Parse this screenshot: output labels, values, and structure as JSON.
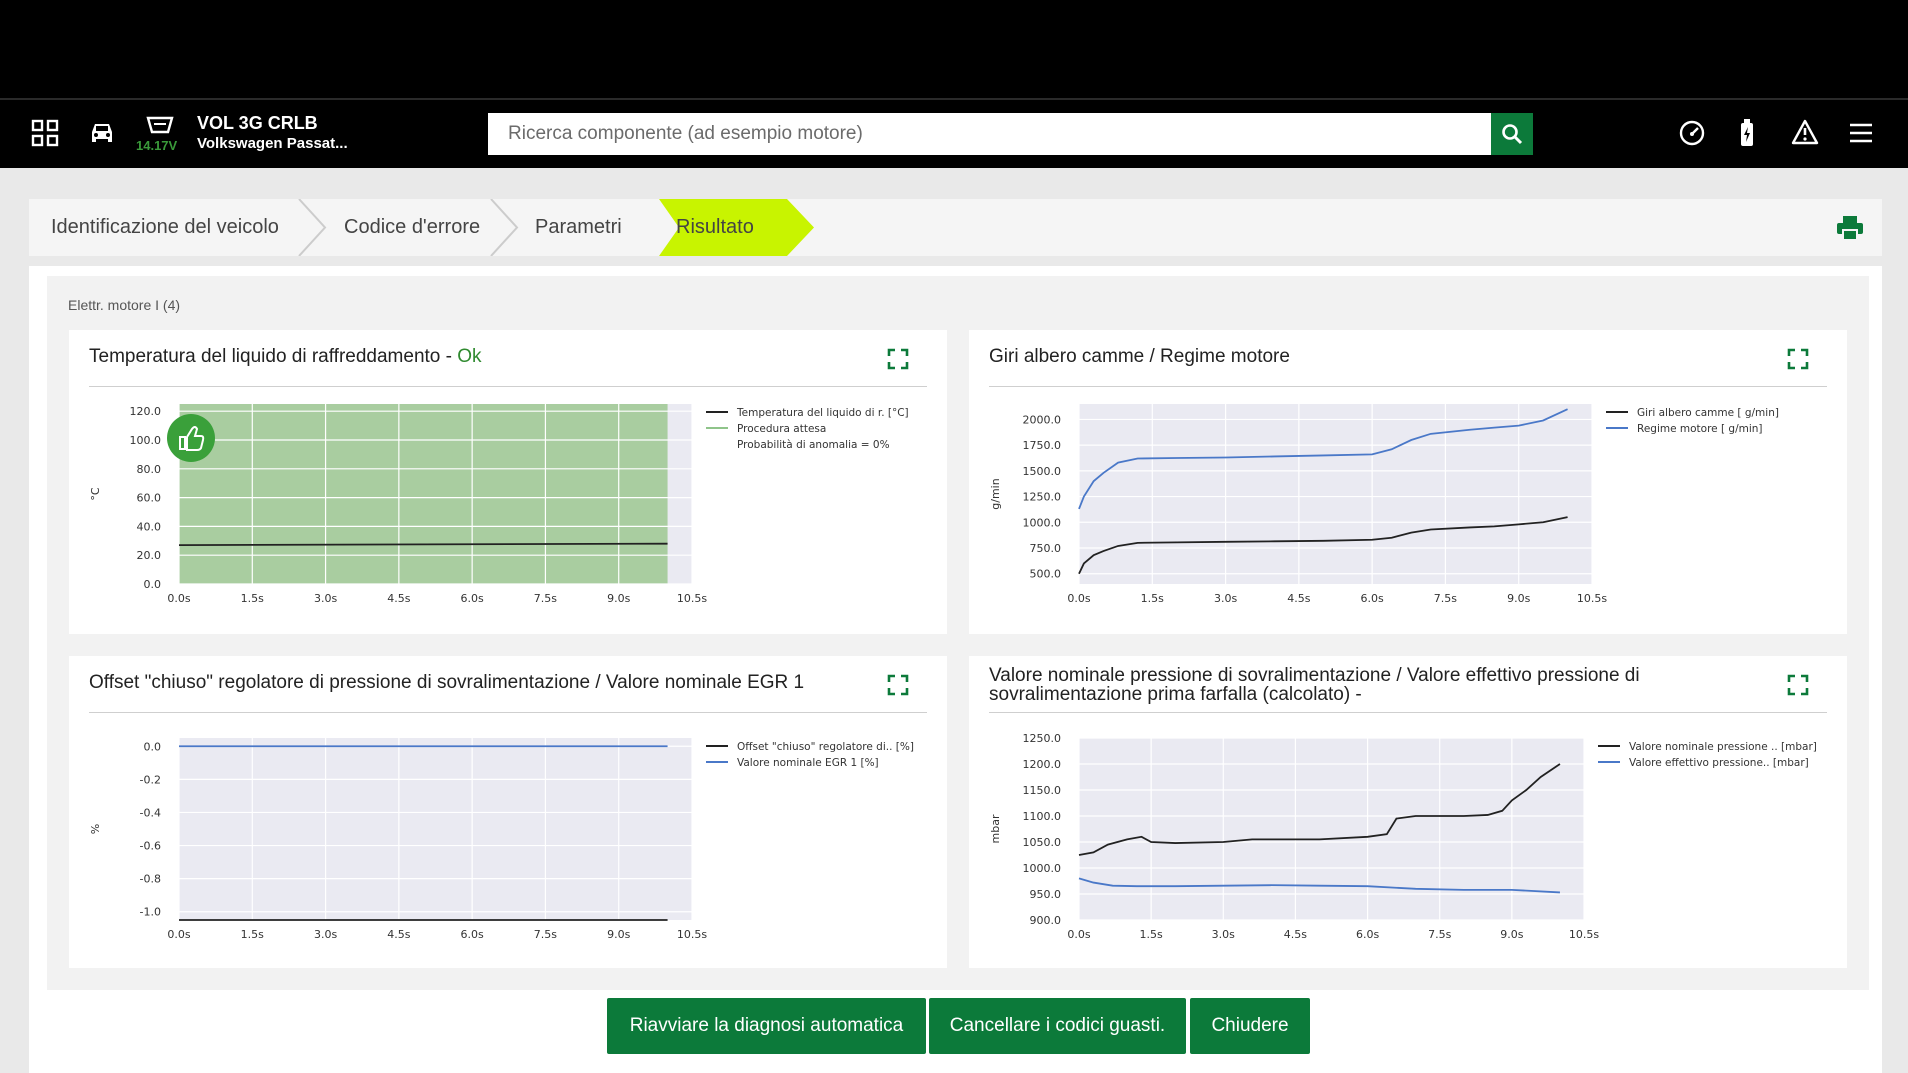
{
  "header": {
    "vehicle_code": "VOL 3G CRLB",
    "vehicle_model": "Volkswagen Passat...",
    "voltage": "14.17V",
    "search_placeholder": "Ricerca componente (ad esempio motore)"
  },
  "breadcrumb": {
    "steps": [
      "Identificazione del veicolo",
      "Codice d'errore",
      "Parametri",
      "Risultato"
    ],
    "active": "Risultato",
    "active_color": "#c8f400"
  },
  "section_label": "Elettr. motore I (4)",
  "panels": [
    {
      "title": "Temperatura del liquido di raffreddamento",
      "status_sep": "-",
      "status": "Ok"
    },
    {
      "title": "Giri albero camme / Regime motore"
    },
    {
      "title": "Offset \"chiuso\" regolatore di pressione di sovralimentazione / Valore nominale EGR 1"
    },
    {
      "title": "Valore nominale pressione di sovralimentazione / Valore effettivo pressione di sovralimentazione prima farfalla (calcolato)  -"
    }
  ],
  "buttons": {
    "restart": "Riavviare la diagnosi automatica",
    "clear": "Cancellare i codici guasti.",
    "close": "Chiudere"
  },
  "colors": {
    "brand_green": "#0c7a3a",
    "series_black": "#222222",
    "series_blue": "#4a78c8"
  },
  "chart_data": [
    {
      "type": "line",
      "title": "Temperatura del liquido di raffreddamento",
      "ylabel": "°C",
      "ylim": [
        0,
        125
      ],
      "yticks": [
        "120.0",
        "100.0",
        "80.0",
        "60.0",
        "40.0",
        "20.0",
        "0.0"
      ],
      "ytick_values": [
        120,
        100,
        80,
        60,
        40,
        20,
        0
      ],
      "xticks": [
        "0.0s",
        "1.5s",
        "3.0s",
        "4.5s",
        "6.0s",
        "7.5s",
        "9.0s",
        "10.5s"
      ],
      "xlim": [
        0,
        10.5
      ],
      "band": {
        "x": [
          0,
          10
        ],
        "y": [
          0,
          130
        ],
        "color": "#a9cda0"
      },
      "series": [
        {
          "name": "Temperatura del liquido di r. [°C]",
          "color": "#222222",
          "x": [
            0,
            10
          ],
          "y": [
            27,
            28
          ]
        },
        {
          "name": "Procedura attesa",
          "color": "#8fc48a",
          "legend_only": true
        }
      ],
      "legend_extra": "Probabilità di anomalia =   0%",
      "legend_position": "right"
    },
    {
      "type": "line",
      "title": "Giri albero camme / Regime motore",
      "ylabel": "g/min",
      "ylim": [
        400,
        2150
      ],
      "yticks": [
        "2000.0",
        "1750.0",
        "1500.0",
        "1250.0",
        "1000.0",
        "750.0",
        "500.0"
      ],
      "ytick_values": [
        2000,
        1750,
        1500,
        1250,
        1000,
        750,
        500
      ],
      "xticks": [
        "0.0s",
        "1.5s",
        "3.0s",
        "4.5s",
        "6.0s",
        "7.5s",
        "9.0s",
        "10.5s"
      ],
      "xlim": [
        0,
        10.5
      ],
      "series": [
        {
          "name": "Giri albero camme [ g/min]",
          "color": "#222222",
          "x": [
            0,
            0.1,
            0.3,
            0.5,
            0.8,
            1.2,
            2,
            3,
            4,
            5,
            6,
            6.4,
            6.8,
            7.2,
            8,
            8.5,
            9,
            9.5,
            10
          ],
          "y": [
            500,
            600,
            680,
            720,
            770,
            800,
            805,
            810,
            815,
            820,
            830,
            850,
            900,
            930,
            950,
            960,
            980,
            1000,
            1050
          ]
        },
        {
          "name": "Regime motore [ g/min]",
          "color": "#4a78c8",
          "x": [
            0,
            0.1,
            0.3,
            0.5,
            0.8,
            1.2,
            2,
            3,
            4,
            5,
            6,
            6.4,
            6.8,
            7.2,
            8,
            8.5,
            9,
            9.5,
            10
          ],
          "y": [
            1130,
            1250,
            1400,
            1480,
            1580,
            1620,
            1625,
            1630,
            1640,
            1650,
            1660,
            1710,
            1800,
            1860,
            1900,
            1920,
            1940,
            1990,
            2100
          ]
        }
      ],
      "legend_position": "right"
    },
    {
      "type": "line",
      "title": "Offset \"chiuso\" regolatore di pressione di sovralimentazione / Valore nominale EGR 1",
      "ylabel": "%",
      "ylim": [
        -1.05,
        0.05
      ],
      "yticks": [
        "0.0",
        "-0.2",
        "-0.4",
        "-0.6",
        "-0.8",
        "-1.0"
      ],
      "ytick_values": [
        0,
        -0.2,
        -0.4,
        -0.6,
        -0.8,
        -1.0
      ],
      "xticks": [
        "0.0s",
        "1.5s",
        "3.0s",
        "4.5s",
        "6.0s",
        "7.5s",
        "9.0s",
        "10.5s"
      ],
      "xlim": [
        0,
        10.5
      ],
      "series": [
        {
          "name": "Offset \"chiuso\" regolatore di.. [%]",
          "color": "#222222",
          "x": [
            0,
            10
          ],
          "y": [
            -1.05,
            -1.05
          ]
        },
        {
          "name": "Valore nominale EGR 1 [%]",
          "color": "#4a78c8",
          "x": [
            0,
            10
          ],
          "y": [
            0,
            0
          ]
        }
      ],
      "legend_position": "right"
    },
    {
      "type": "line",
      "title": "Valore nominale pressione di sovralimentazione / Valore effettivo pressione di sovralimentazione prima farfalla (calcolato)",
      "ylabel": "mbar",
      "ylim": [
        900,
        1250
      ],
      "yticks": [
        "1250.0",
        "1200.0",
        "1150.0",
        "1100.0",
        "1050.0",
        "1000.0",
        "950.0",
        "900.0"
      ],
      "ytick_values": [
        1250,
        1200,
        1150,
        1100,
        1050,
        1000,
        950,
        900
      ],
      "xticks": [
        "0.0s",
        "1.5s",
        "3.0s",
        "4.5s",
        "6.0s",
        "7.5s",
        "9.0s",
        "10.5s"
      ],
      "xlim": [
        0,
        10.5
      ],
      "series": [
        {
          "name": "Valore nominale pressione .. [mbar]",
          "color": "#222222",
          "x": [
            0,
            0.3,
            0.6,
            1,
            1.3,
            1.5,
            2,
            3,
            3.6,
            4,
            5,
            6,
            6.4,
            6.6,
            7,
            8,
            8.5,
            8.8,
            9,
            9.3,
            9.6,
            10
          ],
          "y": [
            1025,
            1030,
            1045,
            1055,
            1060,
            1050,
            1048,
            1050,
            1055,
            1055,
            1055,
            1060,
            1065,
            1095,
            1100,
            1100,
            1102,
            1110,
            1130,
            1150,
            1175,
            1200
          ]
        },
        {
          "name": "Valore effettivo pressione.. [mbar]",
          "color": "#4a78c8",
          "x": [
            0,
            0.3,
            0.7,
            1.2,
            2,
            3,
            4,
            5,
            6,
            7,
            8,
            9,
            10
          ],
          "y": [
            980,
            972,
            966,
            965,
            965,
            966,
            967,
            966,
            965,
            960,
            958,
            958,
            953
          ]
        }
      ],
      "legend_position": "right"
    }
  ]
}
